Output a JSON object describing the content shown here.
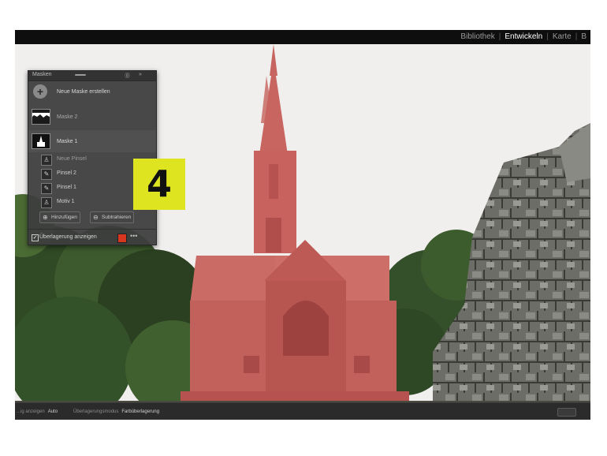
{
  "modules": [
    {
      "label": "Bibliothek",
      "active": false
    },
    {
      "label": "Entwickeln",
      "active": true
    },
    {
      "label": "Karte",
      "active": false
    },
    {
      "label": "B",
      "active": false
    }
  ],
  "masks_panel": {
    "title": "Masken",
    "new_mask_label": "Neue Maske erstellen",
    "masks": [
      {
        "label": "Maske 2",
        "selected": false
      },
      {
        "label": "Maske 1",
        "selected": true
      }
    ],
    "components": [
      {
        "label": "Neue Pinsel",
        "icon": "person-icon"
      },
      {
        "label": "Pinsel 2",
        "icon": "brush-icon"
      },
      {
        "label": "Pinsel 1",
        "icon": "brush-icon"
      },
      {
        "label": "Motiv 1",
        "icon": "person-icon"
      }
    ],
    "add_button": "Hinzufügen",
    "subtract_button": "Subtrahieren",
    "overlay_checkbox_label": "Überlagerung anzeigen",
    "overlay_checked": true,
    "overlay_color": "#d8361f"
  },
  "step_badge": "4",
  "bottom_bar": {
    "overlay_mode_label": "...ig anzeigen",
    "overlay_mode_value": "Auto",
    "overlay_options_label": "Überlagerungsmodus",
    "overlay_options_value": "Farbüberlagerung"
  },
  "colors": {
    "badge": "#dfe421",
    "overlay": "#c62a22"
  }
}
